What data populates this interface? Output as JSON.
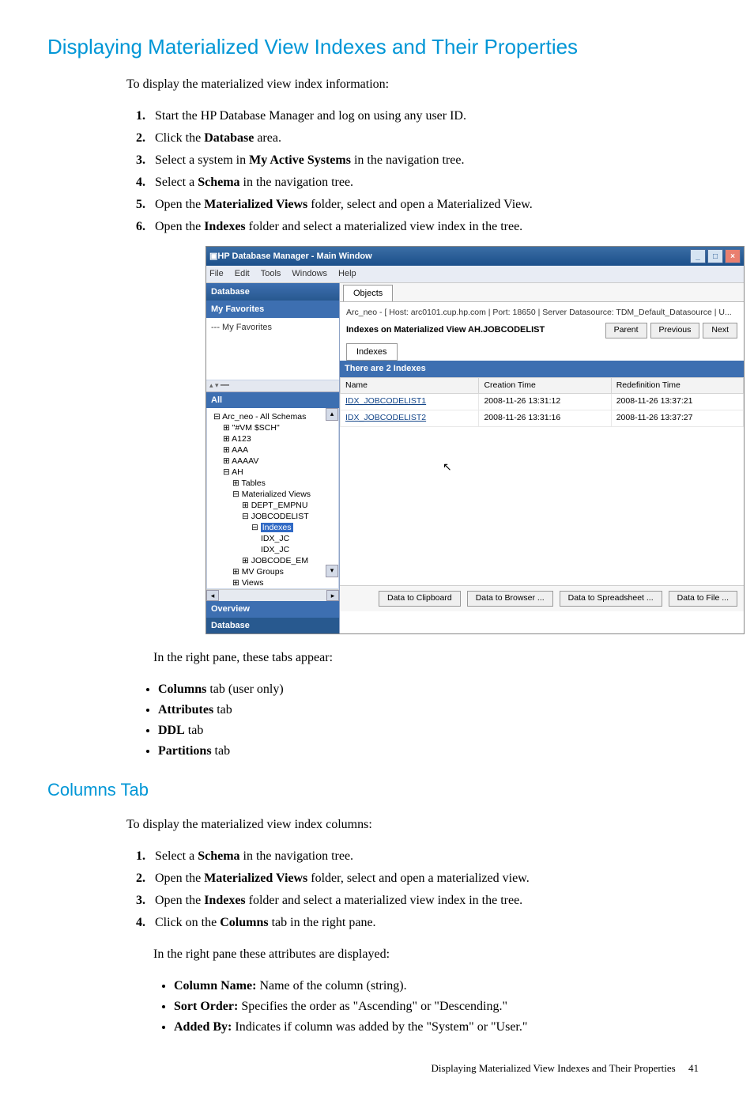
{
  "h1": "Displaying Materialized View Indexes and Their Properties",
  "intro1": "To display the materialized view index information:",
  "steps1": [
    {
      "pre": "Start the HP Database Manager and log on using any user ID."
    },
    {
      "pre": "Click the ",
      "b": "Database",
      "post": " area."
    },
    {
      "pre": "Select a system in ",
      "b": "My Active Systems",
      "post": " in the navigation tree."
    },
    {
      "pre": "Select a ",
      "b": "Schema",
      "post": " in the navigation tree."
    },
    {
      "pre": "Open the ",
      "b": "Materialized Views",
      "post": " folder, select and open a Materialized View."
    },
    {
      "pre": "Open the ",
      "b": "Indexes",
      "post": " folder and select a materialized view index in the tree."
    }
  ],
  "window": {
    "title": "HP Database Manager - Main Window",
    "menus": [
      "File",
      "Edit",
      "Tools",
      "Windows",
      "Help"
    ],
    "left": {
      "database": "Database",
      "favorites_hdr": "My Favorites",
      "favorites_item": "--- My Favorites",
      "mini": "▴  ▾          ━━",
      "all_hdr": "All",
      "tree": [
        {
          "i": 0,
          "t": "⊟ Arc_neo - All Schemas"
        },
        {
          "i": 1,
          "t": "⊞ \"#VM $SCH\""
        },
        {
          "i": 1,
          "t": "⊞ A123"
        },
        {
          "i": 1,
          "t": "⊞ AAA"
        },
        {
          "i": 1,
          "t": "⊞ AAAAV"
        },
        {
          "i": 1,
          "t": "⊟ AH"
        },
        {
          "i": 2,
          "t": "⊞ Tables"
        },
        {
          "i": 2,
          "t": "⊟ Materialized Views"
        },
        {
          "i": 3,
          "t": "⊞ DEPT_EMPNU"
        },
        {
          "i": 3,
          "t": "⊟ JOBCODELIST"
        },
        {
          "i": 4,
          "t": "⊟ ",
          "hl": "Indexes"
        },
        {
          "i": 5,
          "t": "  IDX_JC"
        },
        {
          "i": 5,
          "t": "  IDX_JC"
        },
        {
          "i": 3,
          "t": "⊞ JOBCODE_EM"
        },
        {
          "i": 2,
          "t": "⊞ MV Groups"
        },
        {
          "i": 2,
          "t": "⊞ Views"
        }
      ],
      "overview": "Overview",
      "database2": "Database"
    },
    "right": {
      "objects_tab": "Objects",
      "breadcrumb": "Arc_neo - [ Host: arc0101.cup.hp.com | Port: 18650 | Server Datasource: TDM_Default_Datasource |  U...",
      "subtitle": "Indexes on Materialized View AH.JOBCODELIST",
      "nav": [
        "Parent",
        "Previous",
        "Next"
      ],
      "inner_tab": "Indexes",
      "count": "There are 2 Indexes",
      "columns": [
        "Name",
        "Creation Time",
        "Redefinition Time"
      ],
      "rows": [
        {
          "name": "IDX_JOBCODELIST1",
          "ct": "2008-11-26 13:31:12",
          "rt": "2008-11-26 13:37:21"
        },
        {
          "name": "IDX_JOBCODELIST2",
          "ct": "2008-11-26 13:31:16",
          "rt": "2008-11-26 13:37:27"
        }
      ],
      "buttons": [
        "Data to Clipboard",
        "Data to Browser ...",
        "Data to Spreadsheet ...",
        "Data to File ..."
      ]
    }
  },
  "after_img": "In the right pane, these tabs appear:",
  "tabs_list": [
    {
      "b": "Columns",
      "post": " tab (user only)"
    },
    {
      "b": "Attributes",
      "post": " tab"
    },
    {
      "b": "DDL",
      "post": " tab"
    },
    {
      "b": "Partitions",
      "post": " tab"
    }
  ],
  "h2": "Columns Tab",
  "intro2": "To display the materialized view index columns:",
  "steps2": [
    {
      "pre": "Select a ",
      "b": "Schema",
      "post": " in the navigation tree."
    },
    {
      "pre": "Open the ",
      "b": "Materialized Views",
      "post": " folder, select and open a materialized view."
    },
    {
      "pre": "Open the ",
      "b": "Indexes",
      "post": " folder and select a materialized view index in the tree."
    },
    {
      "pre": "Click on the ",
      "b": "Columns",
      "post": " tab in the right pane."
    }
  ],
  "sub_intro": "In the right pane these attributes are displayed:",
  "attrs": [
    {
      "b": "Column Name:",
      "post": " Name of the column (string)."
    },
    {
      "b": "Sort Order:",
      "post": " Specifies the order as \"Ascending\" or \"Descending.\""
    },
    {
      "b": "Added By:",
      "post": " Indicates if column was added by the \"System\" or \"User.\""
    }
  ],
  "footer_text": "Displaying Materialized View Indexes and Their Properties",
  "footer_page": "41"
}
